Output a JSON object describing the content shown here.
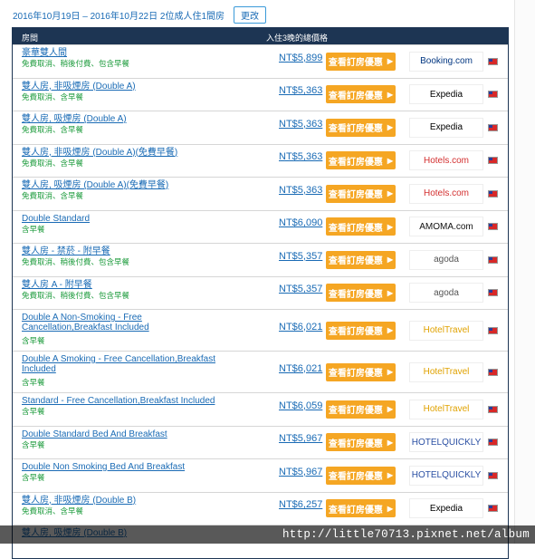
{
  "stay_summary": "2016年10月19日 – 2016年10月22日 2位成人住1間房",
  "change_button": "更改",
  "table": {
    "header_room": "房間",
    "header_price": "入住3晚的總價格",
    "deal_label": "查看訂房優惠",
    "rows": [
      {
        "name": "豪華雙人間",
        "sub": "免費取消、稍後付費、包含早餐",
        "price": "NT$5,899",
        "provider": "Booking.com",
        "provider_color": "#003580",
        "tall": false
      },
      {
        "name": "雙人房, 非吸煙房 (Double A)",
        "sub": "免費取消、含早餐",
        "price": "NT$5,363",
        "provider": "Expedia",
        "provider_color": "#000000",
        "tall": false
      },
      {
        "name": "雙人房, 吸煙房 (Double A)",
        "sub": "免費取消、含早餐",
        "price": "NT$5,363",
        "provider": "Expedia",
        "provider_color": "#000000",
        "tall": false
      },
      {
        "name": "雙人房, 非吸煙房 (Double A)(免費早餐)",
        "sub": "免費取消、含早餐",
        "price": "NT$5,363",
        "provider": "Hotels.com",
        "provider_color": "#d32f2f",
        "tall": false
      },
      {
        "name": "雙人房, 吸煙房 (Double A)(免費早餐)",
        "sub": "免費取消、含早餐",
        "price": "NT$5,363",
        "provider": "Hotels.com",
        "provider_color": "#d32f2f",
        "tall": false
      },
      {
        "name": "Double Standard",
        "sub": "含早餐",
        "price": "NT$6,090",
        "provider": "AMOMA.com",
        "provider_color": "#111111",
        "tall": false
      },
      {
        "name": "雙人房 - 禁菸 - 附早餐",
        "sub": "免費取消、稍後付費、包含早餐",
        "price": "NT$5,357",
        "provider": "agoda",
        "provider_color": "#555555",
        "tall": false
      },
      {
        "name": "雙人房 A - 附早餐",
        "sub": "免費取消、稍後付費、包含早餐",
        "price": "NT$5,357",
        "provider": "agoda",
        "provider_color": "#555555",
        "tall": false
      },
      {
        "name": "Double A Non-Smoking - Free Cancellation,Breakfast Included",
        "sub": "含早餐",
        "price": "NT$6,021",
        "provider": "HotelTravel",
        "provider_color": "#e0a200",
        "tall": true
      },
      {
        "name": "Double A Smoking - Free Cancellation,Breakfast Included",
        "sub": "含早餐",
        "price": "NT$6,021",
        "provider": "HotelTravel",
        "provider_color": "#e0a200",
        "tall": true
      },
      {
        "name": "Standard - Free Cancellation,Breakfast Included",
        "sub": "含早餐",
        "price": "NT$6,059",
        "provider": "HotelTravel",
        "provider_color": "#e0a200",
        "tall": false
      },
      {
        "name": "Double Standard Bed And Breakfast",
        "sub": "含早餐",
        "price": "NT$5,967",
        "provider": "HOTELQUICKLY",
        "provider_color": "#2a4fa3",
        "tall": false
      },
      {
        "name": "Double Non Smoking Bed And Breakfast",
        "sub": "含早餐",
        "price": "NT$5,967",
        "provider": "HOTELQUICKLY",
        "provider_color": "#2a4fa3",
        "tall": false
      },
      {
        "name": "雙人房, 非吸煙房 (Double B)",
        "sub": "免費取消、含早餐",
        "price": "NT$6,257",
        "provider": "Expedia",
        "provider_color": "#000000",
        "tall": false
      },
      {
        "name": "雙人房, 吸煙房 (Double B)",
        "sub": "",
        "price": "",
        "provider": "",
        "provider_color": "#000000",
        "tall": false
      }
    ]
  },
  "watermark": "http://little70713.pixnet.net/album"
}
